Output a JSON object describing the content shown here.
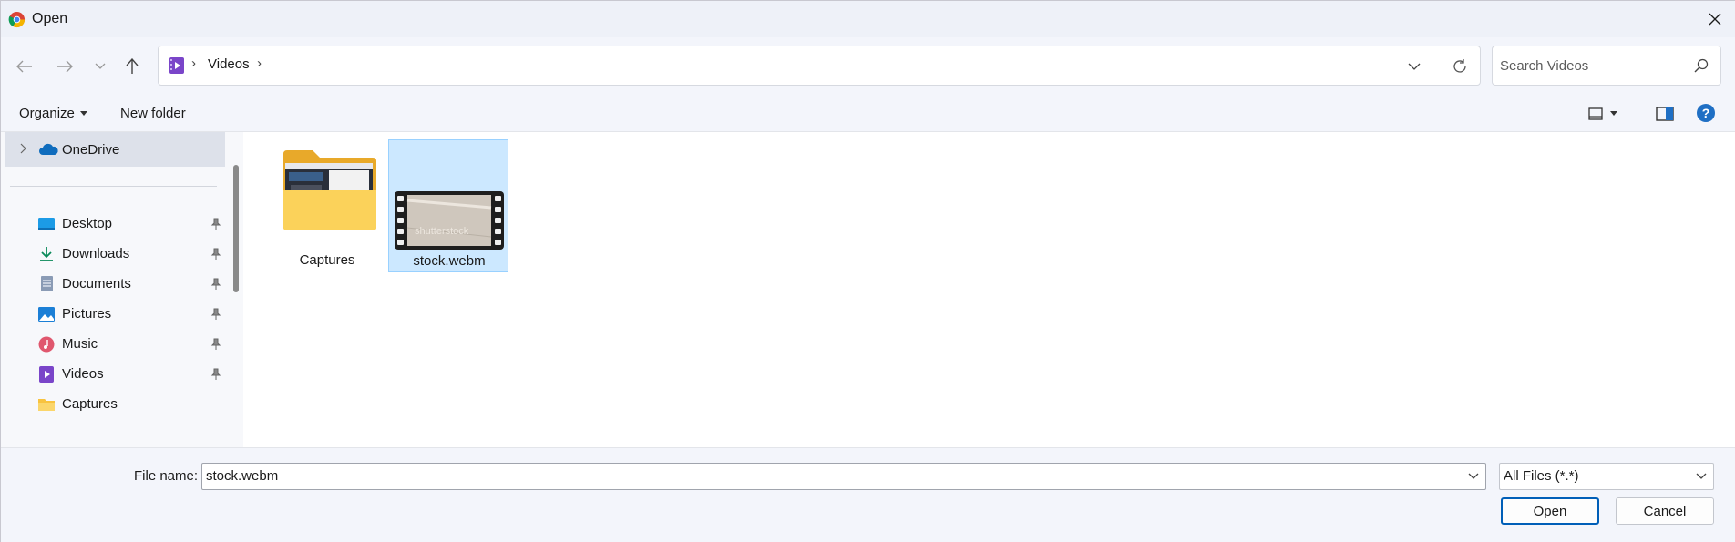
{
  "window": {
    "title": "Open",
    "close_label": "×"
  },
  "nav": {
    "address": "Videos",
    "search_placeholder": "Search Videos"
  },
  "toolbar": {
    "organize": "Organize",
    "new_folder": "New folder"
  },
  "sidebar": {
    "onedrive": "OneDrive",
    "items": [
      {
        "label": "Desktop",
        "icon": "desktop-icon",
        "pinned": true
      },
      {
        "label": "Downloads",
        "icon": "downloads-icon",
        "pinned": true
      },
      {
        "label": "Documents",
        "icon": "documents-icon",
        "pinned": true
      },
      {
        "label": "Pictures",
        "icon": "pictures-icon",
        "pinned": true
      },
      {
        "label": "Music",
        "icon": "music-icon",
        "pinned": true
      },
      {
        "label": "Videos",
        "icon": "videos-icon",
        "pinned": true
      },
      {
        "label": "Captures",
        "icon": "folder-icon",
        "pinned": false
      }
    ]
  },
  "content": {
    "items": [
      {
        "name": "Captures",
        "type": "folder",
        "selected": false
      },
      {
        "name": "stock.webm",
        "type": "video",
        "selected": true,
        "thumbnail_text": "shutterstock"
      }
    ]
  },
  "footer": {
    "file_name_label": "File name:",
    "file_name_value": "stock.webm",
    "file_type": "All Files (*.*)",
    "open_button": "Open",
    "cancel_button": "Cancel"
  },
  "colors": {
    "accent": "#005fb8",
    "selection": "#cce8ff",
    "folder": "#f8c33f"
  }
}
